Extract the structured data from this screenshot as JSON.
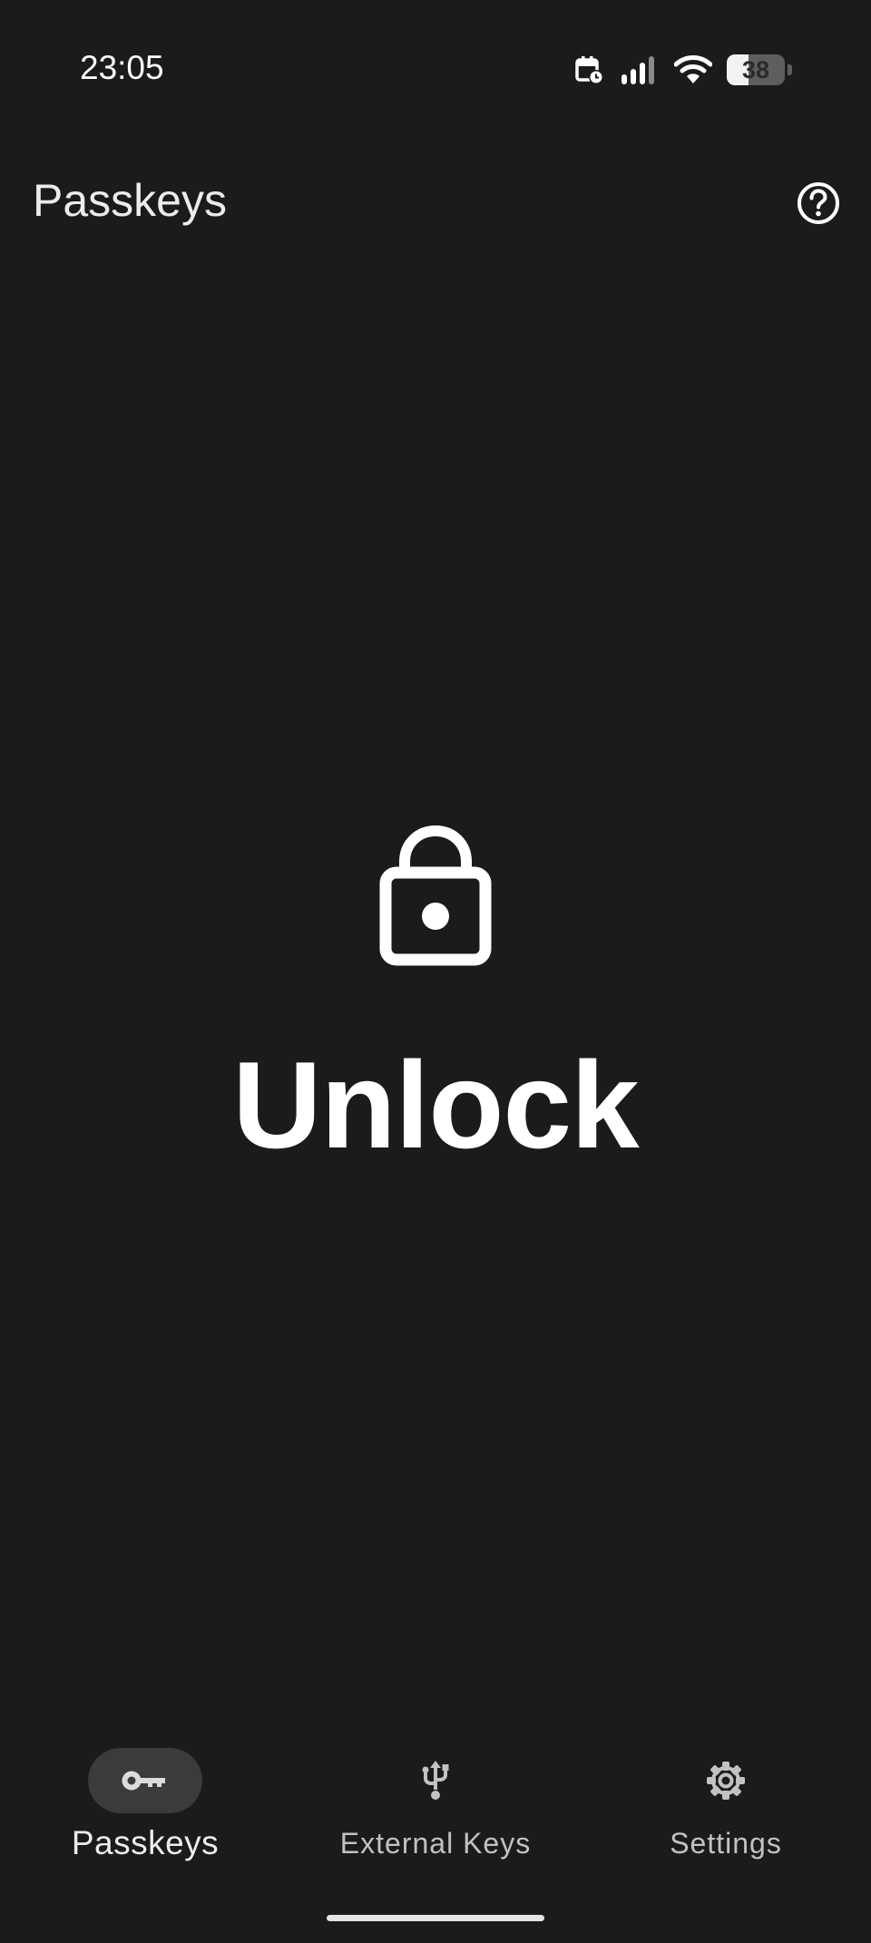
{
  "status_bar": {
    "time": "23:05",
    "battery_level": "38",
    "battery_fraction": 0.38,
    "icons": [
      "calendar-alarm-icon",
      "cellular-signal-icon",
      "wifi-icon",
      "battery-icon"
    ]
  },
  "app_bar": {
    "title": "Passkeys",
    "help_icon": "help-circle-icon"
  },
  "main": {
    "lock_icon": "lock-icon",
    "message": "Unlock"
  },
  "bottom_nav": {
    "items": [
      {
        "label": "Passkeys",
        "icon": "key-icon",
        "selected": true
      },
      {
        "label": "External Keys",
        "icon": "usb-icon",
        "selected": false
      },
      {
        "label": "Settings",
        "icon": "gear-icon",
        "selected": false
      }
    ]
  },
  "colors": {
    "background": "#1b1b1b",
    "active_pill": "#3b3b3b",
    "text_primary": "#ffffff",
    "text_secondary": "#c2c2c2"
  }
}
